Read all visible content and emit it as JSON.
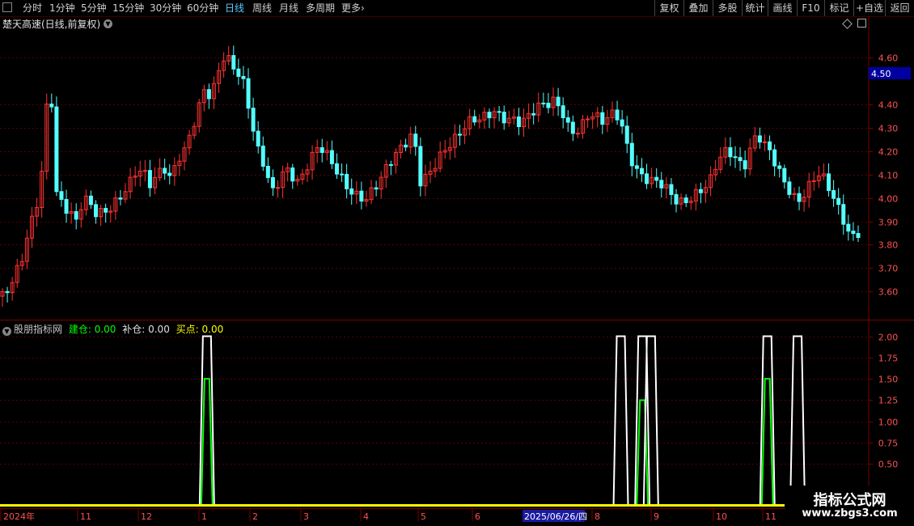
{
  "toolbar": {
    "periods": [
      "分时",
      "1分钟",
      "5分钟",
      "15分钟",
      "30分钟",
      "60分钟",
      "日线",
      "周线",
      "月线",
      "多周期",
      "更多"
    ],
    "active_period": "日线",
    "more_arrow": "›",
    "right_buttons": [
      "复权",
      "叠加",
      "多股",
      "统计",
      "画线",
      "F10",
      "标记",
      "+自选",
      "返回"
    ]
  },
  "main_chart": {
    "title": "楚天高速(日线,前复权)",
    "current_price_label": "4.50",
    "y_ticks": [
      "4.60",
      "4.40",
      "4.30",
      "4.20",
      "4.10",
      "4.00",
      "3.90",
      "3.80",
      "3.70",
      "3.60"
    ],
    "y_tick_values": [
      4.6,
      4.4,
      4.3,
      4.2,
      4.1,
      4.0,
      3.9,
      3.8,
      3.7,
      3.6
    ],
    "ylim": [
      3.48,
      4.77
    ],
    "up_color": "#ff3232",
    "down_color": "#54ffff"
  },
  "sub_chart": {
    "name": "股朋指标网",
    "indicators": [
      {
        "label": "建仓: 0.00",
        "color": "#00ff00"
      },
      {
        "label": "补仓: 0.00",
        "color": "#e0e0e0"
      },
      {
        "label": "买点: 0.00",
        "color": "#ffff00"
      }
    ],
    "y_ticks": [
      "2.00",
      "1.75",
      "1.50",
      "1.25",
      "1.00",
      "0.75",
      "0.50"
    ],
    "y_tick_values": [
      2.0,
      1.75,
      1.5,
      1.25,
      1.0,
      0.75,
      0.5
    ],
    "ylim": [
      0,
      2.1
    ]
  },
  "x_axis": {
    "labels": [
      "2024年",
      "11",
      "12",
      "1",
      "2",
      "3",
      "4",
      "5",
      "6",
      "8",
      "9",
      "10",
      "11"
    ],
    "cursor_date": "2025/06/26/四"
  },
  "watermark": {
    "title": "指标公式网",
    "url": "www.zbgs3.com"
  },
  "chart_data": {
    "type": "candlestick",
    "title": "楚天高速(日线,前复权)",
    "close_path": [
      3.58,
      3.6,
      3.65,
      3.72,
      3.85,
      3.95,
      4.15,
      4.6,
      4.05,
      4.0,
      3.95,
      3.9,
      3.98,
      3.95,
      3.9,
      3.92,
      3.95,
      4.0,
      4.05,
      4.1,
      4.15,
      4.12,
      4.05,
      4.08,
      4.1,
      4.05,
      4.15,
      4.2,
      4.3,
      4.4,
      4.5,
      4.45,
      4.55,
      4.6,
      4.55,
      4.5,
      4.45,
      4.3,
      4.2,
      4.15,
      4.05,
      4.1,
      4.15,
      4.1,
      4.05,
      4.1,
      4.15,
      4.2,
      4.18,
      4.15,
      4.12,
      4.08,
      4.05,
      4.02,
      4.0,
      4.02,
      4.05,
      4.1,
      4.15,
      4.2,
      4.25,
      4.3,
      4.1,
      4.12,
      4.15,
      4.18,
      4.2,
      4.22,
      4.25,
      4.3,
      4.33,
      4.35,
      4.38,
      4.4,
      4.37,
      4.35,
      4.33,
      4.3,
      4.32,
      4.35,
      4.38,
      4.4,
      4.43,
      4.4,
      4.33,
      4.3,
      4.32,
      4.35,
      4.33,
      4.3,
      4.32,
      4.35,
      4.3,
      4.2,
      4.15,
      4.12,
      4.1,
      4.08,
      4.05,
      4.0,
      3.96,
      3.95,
      3.98,
      4.02,
      4.06,
      4.1,
      4.18,
      4.22,
      4.2,
      4.15,
      4.1,
      4.18,
      4.25,
      4.22,
      4.2,
      4.15,
      4.1,
      4.05,
      4.0,
      4.02,
      4.05,
      4.08,
      4.05,
      4.0,
      3.95,
      3.9,
      3.85,
      3.88
    ],
    "sub_signals": [
      {
        "series": "补仓",
        "center_x_pct": 0.24,
        "value": 2.0
      },
      {
        "series": "建仓",
        "center_x_pct": 0.24,
        "value": 1.5
      },
      {
        "series": "补仓",
        "center_x_pct": 0.72,
        "value": 2.0
      },
      {
        "series": "补仓",
        "center_x_pct": 0.745,
        "value": 2.0
      },
      {
        "series": "建仓",
        "center_x_pct": 0.745,
        "value": 1.25
      },
      {
        "series": "补仓",
        "center_x_pct": 0.755,
        "value": 2.0
      },
      {
        "series": "补仓",
        "center_x_pct": 0.89,
        "value": 2.0
      },
      {
        "series": "建仓",
        "center_x_pct": 0.89,
        "value": 1.5
      },
      {
        "series": "补仓",
        "center_x_pct": 0.925,
        "value": 2.0
      }
    ]
  }
}
